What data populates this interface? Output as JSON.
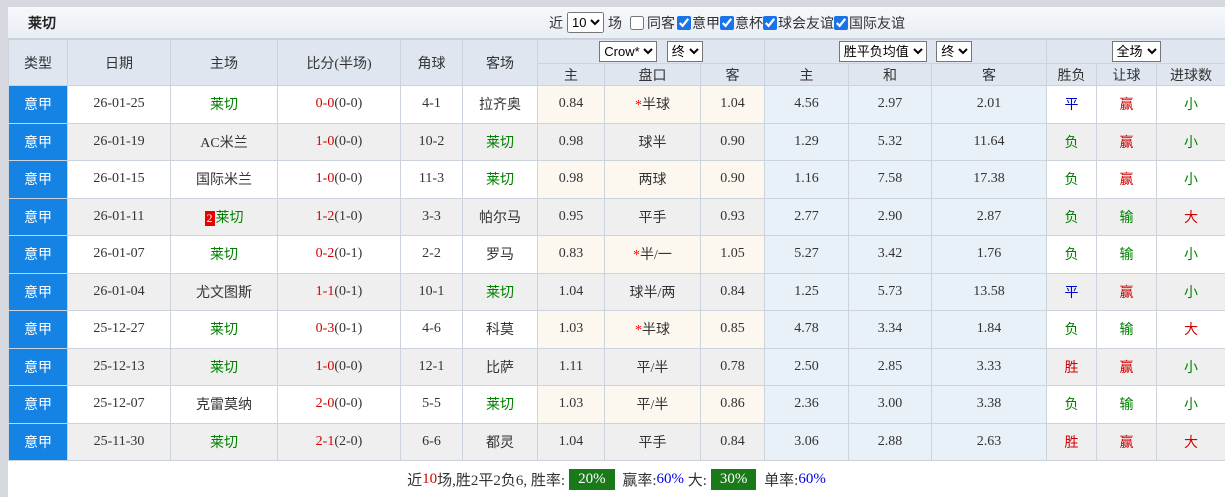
{
  "title": "莱切",
  "colors": {
    "league_cell": "#1583e3",
    "team_green": "#008000",
    "score_red": "#d10000",
    "result_blue": "#0000cc",
    "badge_green": "#1a7a1a",
    "rate_blue": "#0000ee",
    "avg_col_bg": "#e9f1f8",
    "handicap_col_bg": "#fdf8ef"
  },
  "controls": {
    "near_label": "近",
    "matches_count": "10",
    "matches_label": "场",
    "checkboxes": [
      {
        "label": "同客",
        "checked": false
      },
      {
        "label": "意甲",
        "checked": true
      },
      {
        "label": "意杯",
        "checked": true
      },
      {
        "label": "球会友谊",
        "checked": true
      },
      {
        "label": "国际友谊",
        "checked": true
      }
    ]
  },
  "header": {
    "basic_cols": [
      "类型",
      "日期",
      "主场",
      "比分(半场)",
      "角球",
      "客场"
    ],
    "handicap_group": {
      "bookmaker_select": "Crow*",
      "state_select": "终",
      "cols": [
        "主",
        "盘口",
        "客"
      ]
    },
    "avg_group": {
      "name_select": "胜平负均值",
      "state_select": "终",
      "cols": [
        "主",
        "和",
        "客"
      ]
    },
    "result_group": {
      "scope_select": "全场",
      "cols": [
        "胜负",
        "让球",
        "进球数"
      ]
    }
  },
  "rows": [
    {
      "league": "意甲",
      "date": "26-01-25",
      "home": "莱切",
      "home_color": "green",
      "home_badge": "",
      "score": "0-0",
      "half": "(0-0)",
      "corners": "4-1",
      "away": "拉齐奥",
      "away_color": "black",
      "h1": "0.84",
      "handicap_star": true,
      "handicap": "半球",
      "h2": "1.04",
      "avg1": "4.56",
      "avgX": "2.97",
      "avg2": "2.01",
      "result": "平",
      "result_color": "blue",
      "let_result": "赢",
      "let_color": "red",
      "goals": "小",
      "goals_color": "green"
    },
    {
      "league": "意甲",
      "date": "26-01-19",
      "home": "AC米兰",
      "home_color": "black",
      "home_badge": "",
      "score": "1-0",
      "half": "(0-0)",
      "corners": "10-2",
      "away": "莱切",
      "away_color": "green",
      "h1": "0.98",
      "handicap_star": false,
      "handicap": "球半",
      "h2": "0.90",
      "avg1": "1.29",
      "avgX": "5.32",
      "avg2": "11.64",
      "result": "负",
      "result_color": "green",
      "let_result": "赢",
      "let_color": "red",
      "goals": "小",
      "goals_color": "green"
    },
    {
      "league": "意甲",
      "date": "26-01-15",
      "home": "国际米兰",
      "home_color": "black",
      "home_badge": "",
      "score": "1-0",
      "half": "(0-0)",
      "corners": "11-3",
      "away": "莱切",
      "away_color": "green",
      "h1": "0.98",
      "handicap_star": false,
      "handicap": "两球",
      "h2": "0.90",
      "avg1": "1.16",
      "avgX": "7.58",
      "avg2": "17.38",
      "result": "负",
      "result_color": "green",
      "let_result": "赢",
      "let_color": "red",
      "goals": "小",
      "goals_color": "green"
    },
    {
      "league": "意甲",
      "date": "26-01-11",
      "home": "莱切",
      "home_color": "green",
      "home_badge": "2",
      "score": "1-2",
      "half": "(1-0)",
      "corners": "3-3",
      "away": "帕尔马",
      "away_color": "black",
      "h1": "0.95",
      "handicap_star": false,
      "handicap": "平手",
      "h2": "0.93",
      "avg1": "2.77",
      "avgX": "2.90",
      "avg2": "2.87",
      "result": "负",
      "result_color": "green",
      "let_result": "输",
      "let_color": "green",
      "goals": "大",
      "goals_color": "red"
    },
    {
      "league": "意甲",
      "date": "26-01-07",
      "home": "莱切",
      "home_color": "green",
      "home_badge": "",
      "score": "0-2",
      "half": "(0-1)",
      "corners": "2-2",
      "away": "罗马",
      "away_color": "black",
      "h1": "0.83",
      "handicap_star": true,
      "handicap": "半/一",
      "h2": "1.05",
      "avg1": "5.27",
      "avgX": "3.42",
      "avg2": "1.76",
      "result": "负",
      "result_color": "green",
      "let_result": "输",
      "let_color": "green",
      "goals": "小",
      "goals_color": "green"
    },
    {
      "league": "意甲",
      "date": "26-01-04",
      "home": "尤文图斯",
      "home_color": "black",
      "home_badge": "",
      "score": "1-1",
      "half": "(0-1)",
      "corners": "10-1",
      "away": "莱切",
      "away_color": "green",
      "h1": "1.04",
      "handicap_star": false,
      "handicap": "球半/两",
      "h2": "0.84",
      "avg1": "1.25",
      "avgX": "5.73",
      "avg2": "13.58",
      "result": "平",
      "result_color": "blue",
      "let_result": "赢",
      "let_color": "red",
      "goals": "小",
      "goals_color": "green"
    },
    {
      "league": "意甲",
      "date": "25-12-27",
      "home": "莱切",
      "home_color": "green",
      "home_badge": "",
      "score": "0-3",
      "half": "(0-1)",
      "corners": "4-6",
      "away": "科莫",
      "away_color": "black",
      "h1": "1.03",
      "handicap_star": true,
      "handicap": "半球",
      "h2": "0.85",
      "avg1": "4.78",
      "avgX": "3.34",
      "avg2": "1.84",
      "result": "负",
      "result_color": "green",
      "let_result": "输",
      "let_color": "green",
      "goals": "大",
      "goals_color": "red"
    },
    {
      "league": "意甲",
      "date": "25-12-13",
      "home": "莱切",
      "home_color": "green",
      "home_badge": "",
      "score": "1-0",
      "half": "(0-0)",
      "corners": "12-1",
      "away": "比萨",
      "away_color": "black",
      "h1": "1.11",
      "handicap_star": false,
      "handicap": "平/半",
      "h2": "0.78",
      "avg1": "2.50",
      "avgX": "2.85",
      "avg2": "3.33",
      "result": "胜",
      "result_color": "red",
      "let_result": "赢",
      "let_color": "red",
      "goals": "小",
      "goals_color": "green"
    },
    {
      "league": "意甲",
      "date": "25-12-07",
      "home": "克雷莫纳",
      "home_color": "black",
      "home_badge": "",
      "score": "2-0",
      "half": "(0-0)",
      "corners": "5-5",
      "away": "莱切",
      "away_color": "green",
      "h1": "1.03",
      "handicap_star": false,
      "handicap": "平/半",
      "h2": "0.86",
      "avg1": "2.36",
      "avgX": "3.00",
      "avg2": "3.38",
      "result": "负",
      "result_color": "green",
      "let_result": "输",
      "let_color": "green",
      "goals": "小",
      "goals_color": "green"
    },
    {
      "league": "意甲",
      "date": "25-11-30",
      "home": "莱切",
      "home_color": "green",
      "home_badge": "",
      "score": "2-1",
      "half": "(2-0)",
      "corners": "6-6",
      "away": "都灵",
      "away_color": "black",
      "h1": "1.04",
      "handicap_star": false,
      "handicap": "平手",
      "h2": "0.84",
      "avg1": "3.06",
      "avgX": "2.88",
      "avg2": "2.63",
      "result": "胜",
      "result_color": "red",
      "let_result": "赢",
      "let_color": "red",
      "goals": "大",
      "goals_color": "red"
    }
  ],
  "summary": {
    "near": "近",
    "count": "10",
    "tail": "场,胜2平2负6, 胜率:",
    "win_rate": "20%",
    "label_win_odds": " 赢率:",
    "win_odds": "60%",
    "label_big": " 大:",
    "big_rate": "30%",
    "label_single": " 单率:",
    "single_rate": "60%"
  }
}
